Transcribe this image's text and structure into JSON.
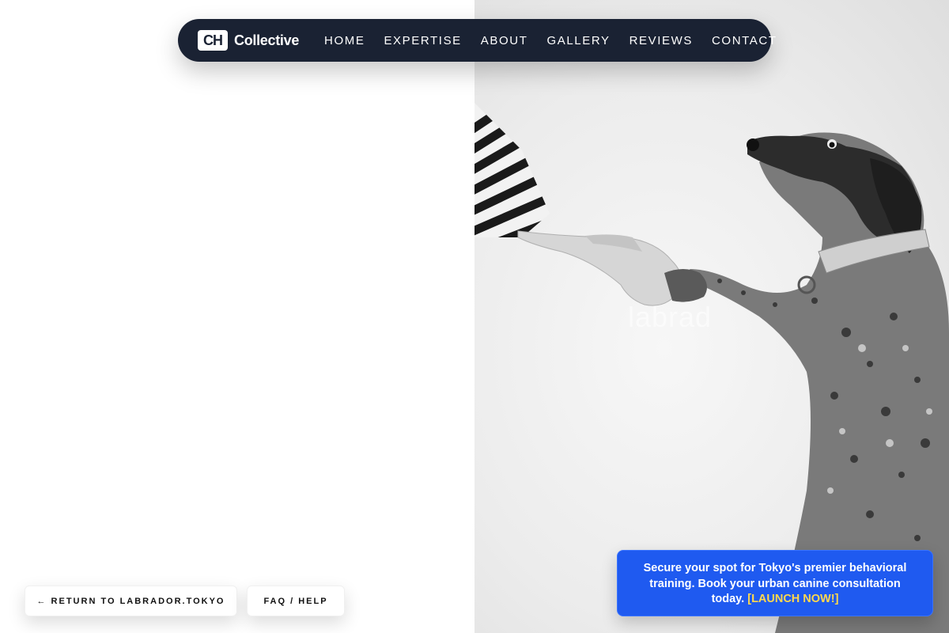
{
  "nav": {
    "logo_mark": "CH",
    "logo_text": "Collective",
    "links": [
      "HOME",
      "EXPERTISE",
      "ABOUT",
      "GALLERY",
      "REVIEWS",
      "CONTACT"
    ]
  },
  "hero": {
    "watermark": "labrad"
  },
  "footer_buttons": {
    "return_label": "← RETURN TO LABRADOR.TOKYO",
    "faq_label": "FAQ / HELP"
  },
  "promo": {
    "text": "Secure your spot for Tokyo's premier behavioral training. Book your urban canine consultation today.",
    "cta": "[LAUNCH NOW!]",
    "bg_color": "#1f5af0",
    "cta_color": "#ffd84d"
  },
  "colors": {
    "navbar_bg": "#1a2233"
  }
}
